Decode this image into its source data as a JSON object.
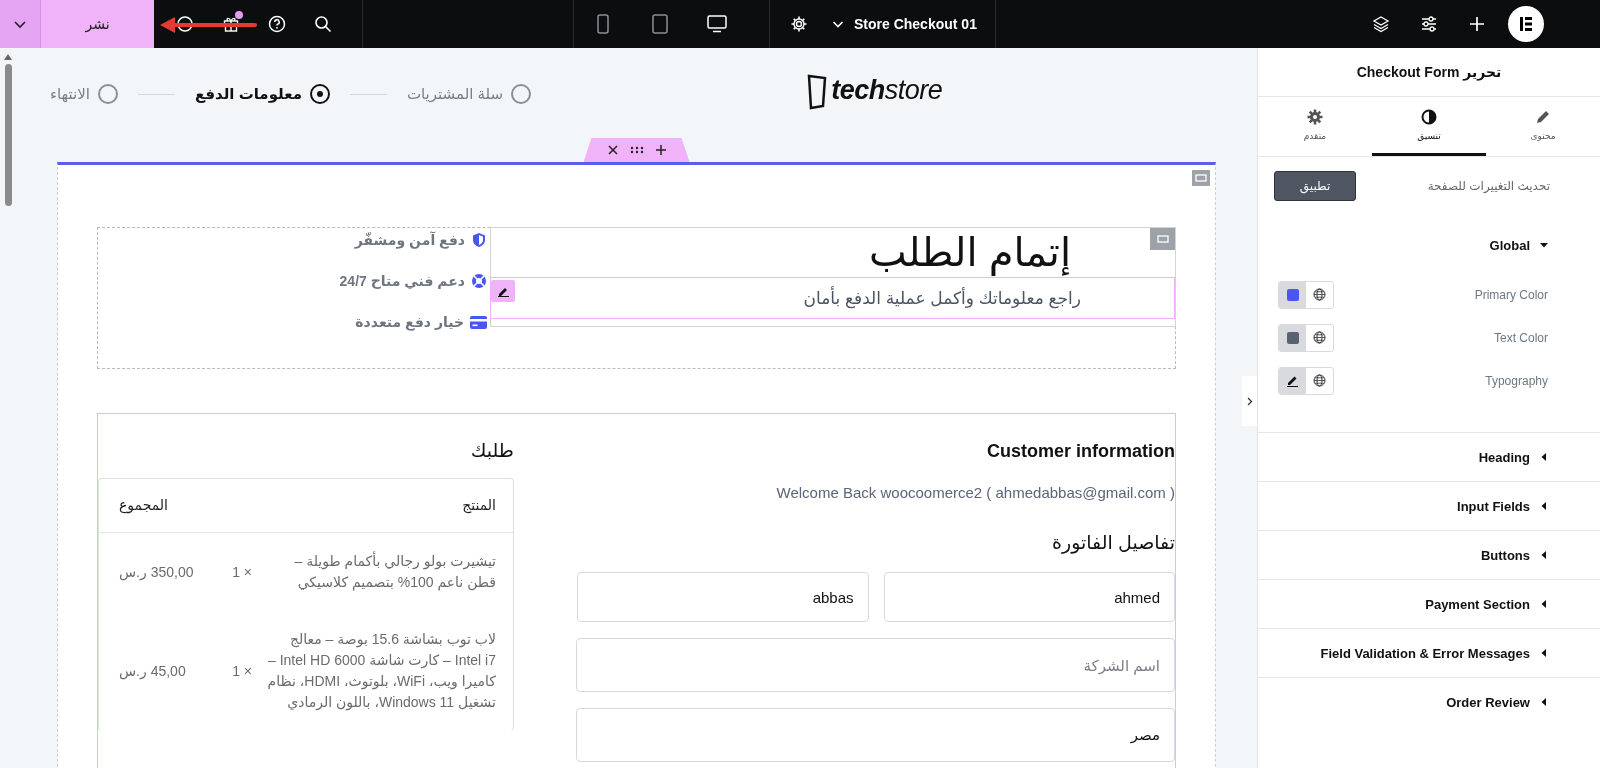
{
  "top_bar": {
    "publish_button": "نشر",
    "devices": [
      {
        "kind": "mobile",
        "selected": false
      },
      {
        "kind": "tablet",
        "selected": false
      },
      {
        "kind": "desktop",
        "selected": true
      }
    ],
    "page_title": "Store Checkout 01"
  },
  "canvas": {
    "logo": "**tech**store",
    "steps": [
      {
        "label": "سلة المشتريات",
        "selected": false
      },
      {
        "label": "معلومات الدفع",
        "selected": true
      },
      {
        "label": "الانتهاء",
        "selected": false
      }
    ],
    "hero": {
      "features": [
        {
          "kind": "shield",
          "text": "دفع آمن ومشفّر"
        },
        {
          "kind": "lifebuoy",
          "text": "دعم فني متاح 24/7"
        },
        {
          "kind": "card",
          "text": "خيار دفع متعددة"
        }
      ],
      "title": "إتمام الطلب",
      "subtitle": "راجع معلوماتك وأكمل عملية الدفع بأمان"
    },
    "order": {
      "title": "طلبك",
      "columns": [
        "المنتج",
        "المجموع"
      ],
      "rows": [
        {
          "product": "تيشيرت بولو رجالي بأكمام طويلة – قطن ناعم 100% بتصميم كلاسيكي",
          "quantity": "× 1",
          "total": "350,00 ر.س"
        },
        {
          "product": "لاب توب بشاشة 15.6 بوصة – معالج Intel i7 – كارت شاشة Intel HD 6000 – كاميرا ويب، WiFi، بلوتوث، HDMI، نظام تشغيل Windows 11، باللون الرمادي",
          "quantity": "× 1",
          "total": "45,00 ر.س"
        }
      ]
    },
    "customer": {
      "title": "Customer information",
      "welcome": "Welcome Back woocoomerce2 ( ahmedabbas@gmail.com )",
      "billing_title": "تفاصيل الفاتورة",
      "fields": [
        {
          "value": "ahmed"
        },
        {
          "value": "abbas"
        },
        {
          "placeholder": "اسم الشركة"
        },
        {
          "value": "مصر"
        }
      ]
    }
  },
  "panel": {
    "title": "تحرير Checkout Form",
    "tabs": [
      {
        "kind": "pencil",
        "label": "محتوى",
        "selected": false
      },
      {
        "kind": "contrast",
        "label": "تنسيق",
        "selected": true
      },
      {
        "kind": "gear",
        "label": "متقدم",
        "selected": false
      }
    ],
    "apply_label": "تحديث التغييرات للصفحة",
    "apply_button": "تطبيق",
    "sections": [
      {
        "title": "Global",
        "expanded": true,
        "controls": [
          {
            "kind": "color",
            "label": "Primary Color",
            "color": "#4a55f5"
          },
          {
            "kind": "color",
            "label": "Text Color",
            "color": "#5a6270"
          },
          {
            "kind": "typography",
            "label": "Typography"
          }
        ]
      },
      {
        "title": "Heading",
        "expanded": false
      },
      {
        "title": "Input Fields",
        "expanded": false
      },
      {
        "title": "Buttons",
        "expanded": false
      },
      {
        "title": "Payment Section",
        "expanded": false
      },
      {
        "title": "Field Validation & Error Messages",
        "expanded": false
      },
      {
        "title": "Order Review",
        "expanded": false
      }
    ]
  }
}
